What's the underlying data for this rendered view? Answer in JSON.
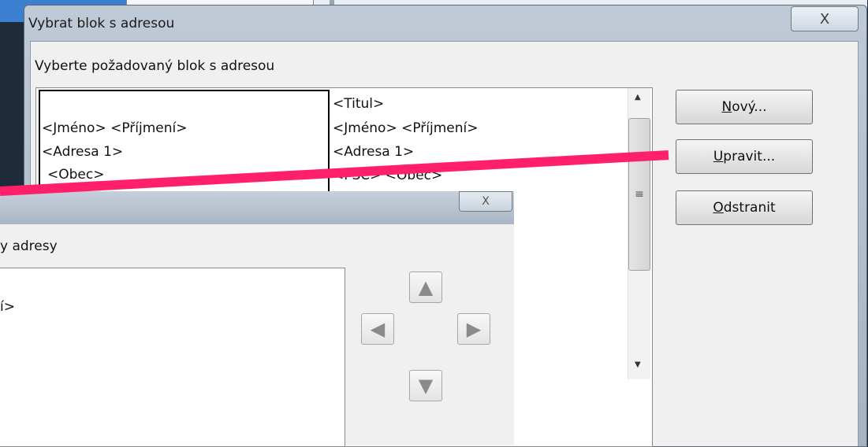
{
  "dialog": {
    "title": "Vybrat blok s adresou",
    "close_glyph": "X",
    "prompt": "Vyberte požadovaný blok s adresou",
    "blocks": [
      {
        "lines": [
          "",
          "<Jméno> <Příjmení>",
          "<Adresa 1>",
          "<Obec>"
        ]
      },
      {
        "lines": [
          "<Titul>",
          "<Jméno> <Příjmení>",
          "<Adresa 1>",
          "<PSČ> <Obec>"
        ]
      }
    ],
    "buttons": [
      {
        "pre": "",
        "accel": "N",
        "post": "ový..."
      },
      {
        "pre": "",
        "accel": "U",
        "post": "pravit..."
      },
      {
        "pre": "",
        "accel": "O",
        "post": "dstranit"
      }
    ]
  },
  "edit_dialog": {
    "close_glyph": "X",
    "label_partial": "y adresy",
    "list_line_partial": "í>",
    "move_buttons": [
      "up-arrow-icon",
      "left-arrow-icon",
      "right-arrow-icon",
      "down-arrow-icon"
    ]
  },
  "colors": {
    "pointer": "#ff1f6b",
    "title_bar": "#b3bfcc"
  }
}
